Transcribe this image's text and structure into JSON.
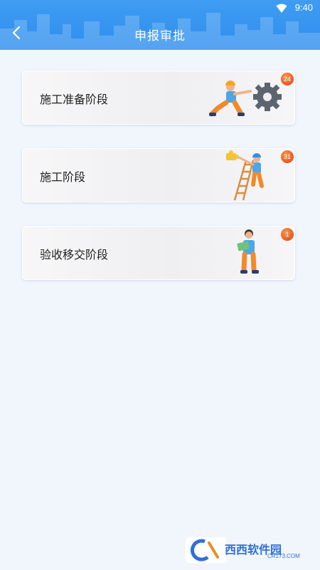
{
  "status_bar": {
    "time": "9:40"
  },
  "header": {
    "title": "申报审批"
  },
  "cards": [
    {
      "label": "施工准备阶段",
      "badge": "24"
    },
    {
      "label": "施工阶段",
      "badge": "31"
    },
    {
      "label": "验收移交阶段",
      "badge": "1"
    }
  ],
  "colors": {
    "header": "#2f8ef0",
    "badge": "#e8581f",
    "page_bg": "#f1f5fc"
  },
  "watermark": {
    "brand": "西西软件园",
    "domain": "CR173.COM"
  }
}
